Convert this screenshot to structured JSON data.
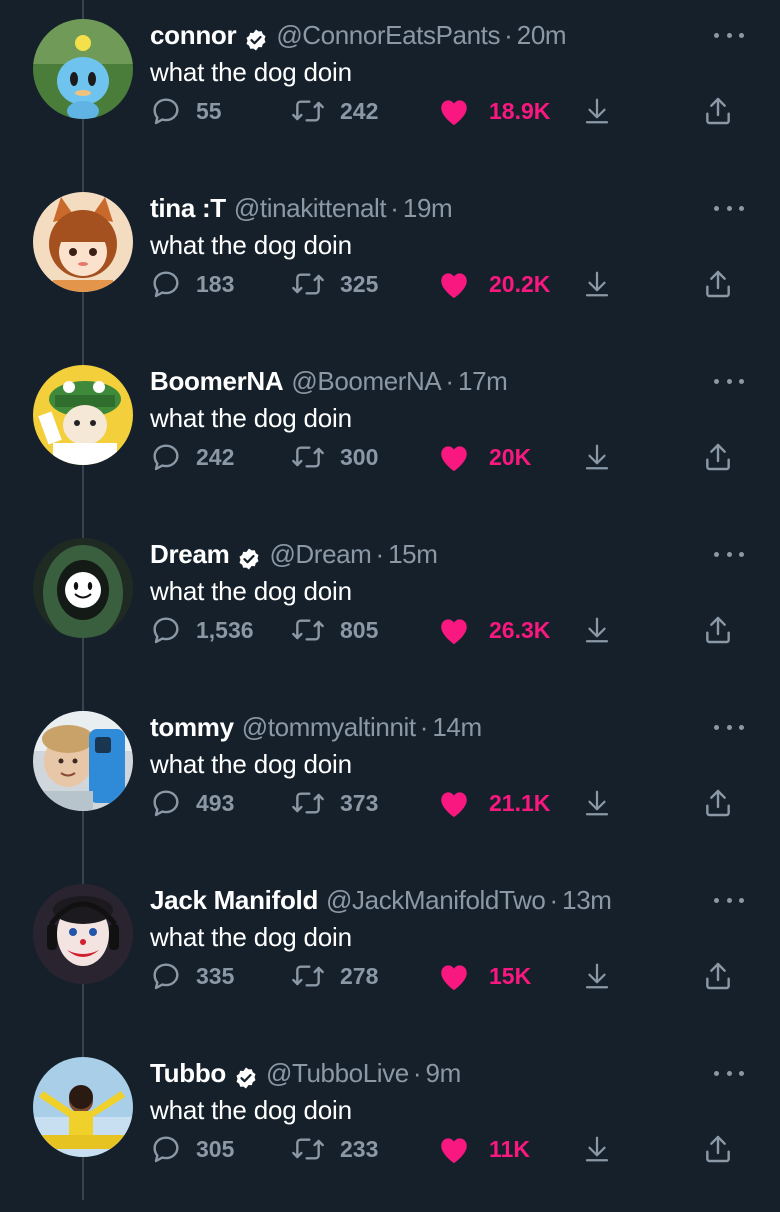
{
  "colors": {
    "background": "#15202b",
    "text_primary": "#ffffff",
    "text_secondary": "#8b98a5",
    "like_pink": "#f91880",
    "thread_line": "#38444d"
  },
  "icons": {
    "reply": "reply-icon",
    "retweet": "retweet-icon",
    "like": "heart-icon",
    "download": "download-icon",
    "share": "share-icon",
    "more": "more-dots-icon",
    "verified": "verified-badge-icon"
  },
  "tweets": [
    {
      "name": "connor",
      "verified": true,
      "handle": "@ConnorEatsPants",
      "time": "20m",
      "text": "what the dog doin",
      "replies": "55",
      "retweets": "242",
      "likes": "18.9K",
      "liked": true
    },
    {
      "name": "tina :T",
      "verified": false,
      "handle": "@tinakittenalt",
      "time": "19m",
      "text": "what the dog doin",
      "replies": "183",
      "retweets": "325",
      "likes": "20.2K",
      "liked": true
    },
    {
      "name": "BoomerNA",
      "verified": false,
      "handle": "@BoomerNA",
      "time": "17m",
      "text": "what the dog doin",
      "replies": "242",
      "retweets": "300",
      "likes": "20K",
      "liked": true
    },
    {
      "name": "Dream",
      "verified": true,
      "handle": "@Dream",
      "time": "15m",
      "text": "what the dog doin",
      "replies": "1,536",
      "retweets": "805",
      "likes": "26.3K",
      "liked": true
    },
    {
      "name": "tommy",
      "verified": false,
      "handle": "@tommyaltinnit",
      "time": "14m",
      "text": "what the dog doin",
      "replies": "493",
      "retweets": "373",
      "likes": "21.1K",
      "liked": true
    },
    {
      "name": "Jack Manifold",
      "verified": false,
      "handle": "@JackManifoldTwo",
      "time": "13m",
      "text": "what the dog doin",
      "replies": "335",
      "retweets": "278",
      "likes": "15K",
      "liked": true
    },
    {
      "name": "Tubbo",
      "verified": true,
      "handle": "@TubboLive",
      "time": "9m",
      "text": "what the dog doin",
      "replies": "305",
      "retweets": "233",
      "likes": "11K",
      "liked": true
    }
  ]
}
